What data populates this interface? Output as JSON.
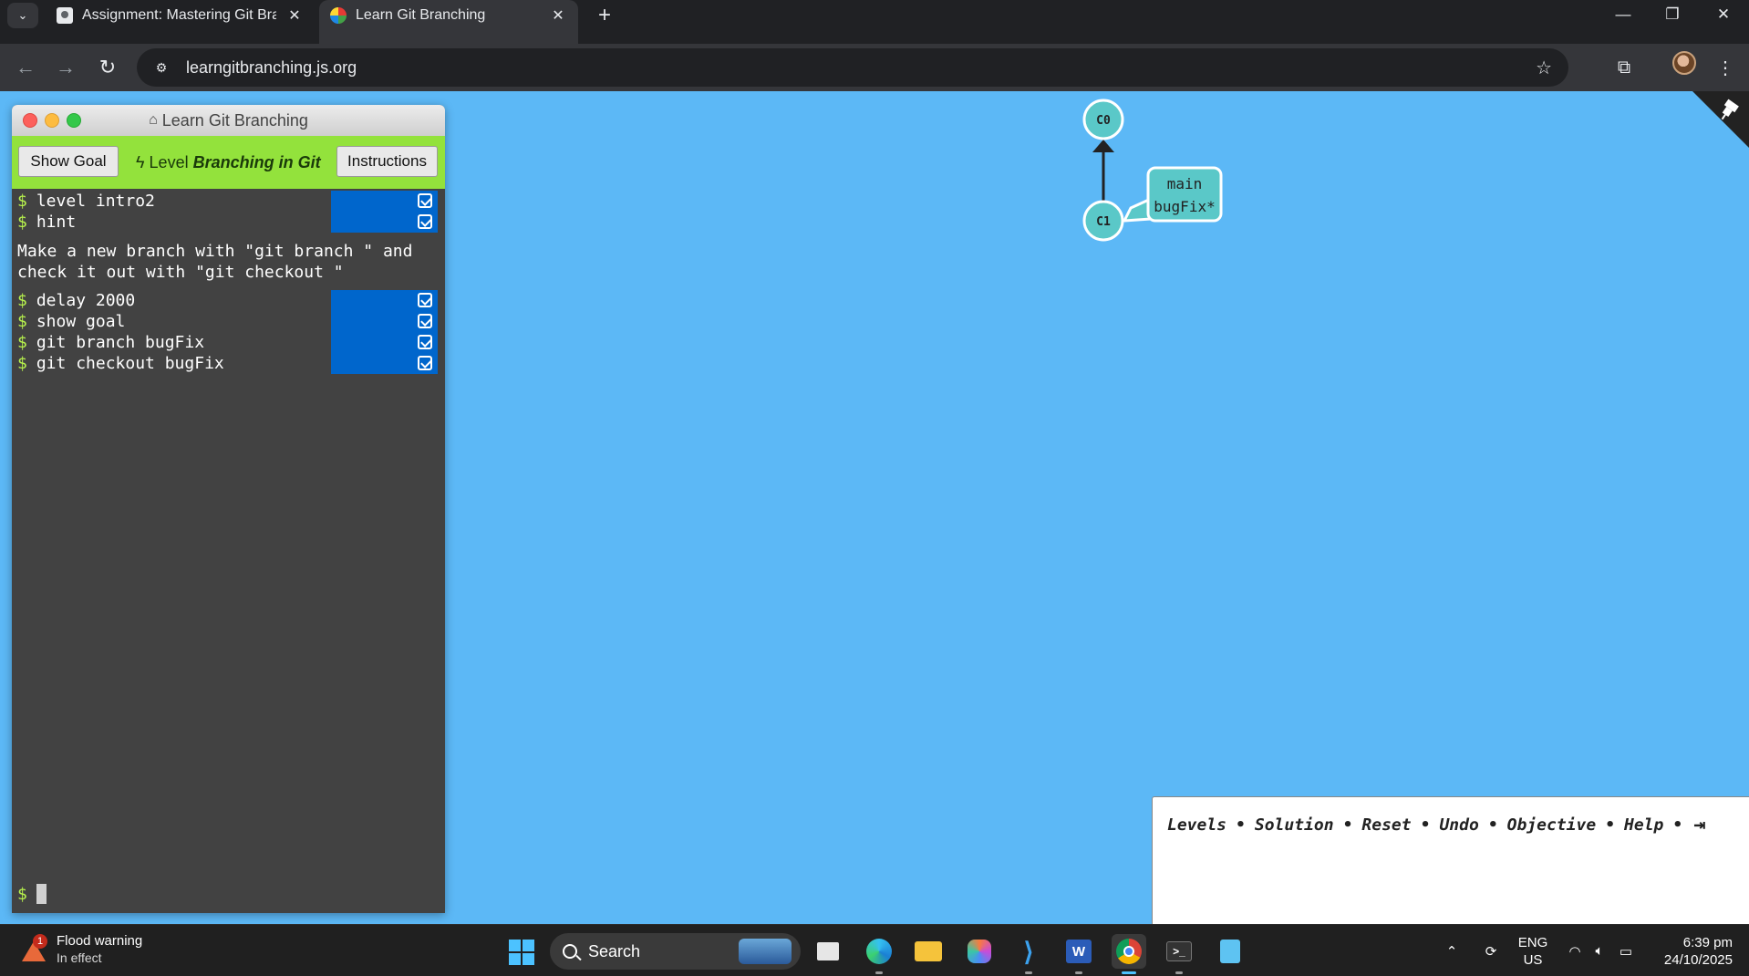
{
  "browser": {
    "tabs": [
      {
        "title": "Assignment: Mastering Git Bran",
        "active": false
      },
      {
        "title": "Learn Git Branching",
        "active": true
      }
    ],
    "url": "learngitbranching.js.org"
  },
  "terminal": {
    "title": "Learn Git Branching",
    "show_goal_label": "Show Goal",
    "level_prefix": "Level",
    "level_name": "Branching in Git",
    "instructions_label": "Instructions",
    "commands_top": [
      "level intro2",
      "hint"
    ],
    "hint": "Make a new branch with \"git branch \" and check it out with \"git checkout \"",
    "commands_bottom": [
      "delay 2000",
      "show goal",
      "git branch bugFix",
      "git checkout bugFix"
    ],
    "prompt": "$"
  },
  "graph": {
    "commits": [
      {
        "id": "C0",
        "parent": null
      },
      {
        "id": "C1",
        "parent": "C0"
      }
    ],
    "branches": [
      {
        "name": "main",
        "target": "C1"
      },
      {
        "name": "bugFix*",
        "target": "C1"
      }
    ],
    "colors": {
      "commit": "#5ac8c8",
      "branch_box": "#5ac8c8",
      "background": "#5cb8f6"
    }
  },
  "command_bar": {
    "links": [
      "Levels",
      "Solution",
      "Reset",
      "Undo",
      "Objective",
      "Help"
    ],
    "separator": "•"
  },
  "taskbar": {
    "weather_title": "Flood warning",
    "weather_sub": "In effect",
    "weather_badge": "1",
    "search_label": "Search",
    "lang_top": "ENG",
    "lang_bottom": "US",
    "time": "6:39 pm",
    "date": "24/10/2025"
  }
}
